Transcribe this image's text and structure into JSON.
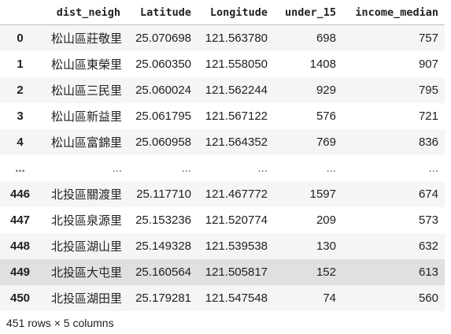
{
  "table": {
    "columns": [
      "",
      "dist_neigh",
      "Latitude",
      "Longitude",
      "under_15",
      "income_median"
    ],
    "rows": [
      {
        "index": "0",
        "dist_neigh": "松山區莊敬里",
        "Latitude": "25.070698",
        "Longitude": "121.563780",
        "under_15": "698",
        "income_median": "757"
      },
      {
        "index": "1",
        "dist_neigh": "松山區東榮里",
        "Latitude": "25.060350",
        "Longitude": "121.558050",
        "under_15": "1408",
        "income_median": "907"
      },
      {
        "index": "2",
        "dist_neigh": "松山區三民里",
        "Latitude": "25.060024",
        "Longitude": "121.562244",
        "under_15": "929",
        "income_median": "795"
      },
      {
        "index": "3",
        "dist_neigh": "松山區新益里",
        "Latitude": "25.061795",
        "Longitude": "121.567122",
        "under_15": "576",
        "income_median": "721"
      },
      {
        "index": "4",
        "dist_neigh": "松山區富錦里",
        "Latitude": "25.060958",
        "Longitude": "121.564352",
        "under_15": "769",
        "income_median": "836"
      },
      {
        "index": "...",
        "dist_neigh": "...",
        "Latitude": "...",
        "Longitude": "...",
        "under_15": "...",
        "income_median": "..."
      },
      {
        "index": "446",
        "dist_neigh": "北投區關渡里",
        "Latitude": "25.117710",
        "Longitude": "121.467772",
        "under_15": "1597",
        "income_median": "674"
      },
      {
        "index": "447",
        "dist_neigh": "北投區泉源里",
        "Latitude": "25.153236",
        "Longitude": "121.520774",
        "under_15": "209",
        "income_median": "573"
      },
      {
        "index": "448",
        "dist_neigh": "北投區湖山里",
        "Latitude": "25.149328",
        "Longitude": "121.539538",
        "under_15": "130",
        "income_median": "632"
      },
      {
        "index": "449",
        "dist_neigh": "北投區大屯里",
        "Latitude": "25.160564",
        "Longitude": "121.505817",
        "under_15": "152",
        "income_median": "613"
      },
      {
        "index": "450",
        "dist_neigh": "北投區湖田里",
        "Latitude": "25.179281",
        "Longitude": "121.547548",
        "under_15": "74",
        "income_median": "560"
      }
    ],
    "hovered_row_index": "449"
  },
  "footer": {
    "summary": "451 rows × 5 columns"
  }
}
